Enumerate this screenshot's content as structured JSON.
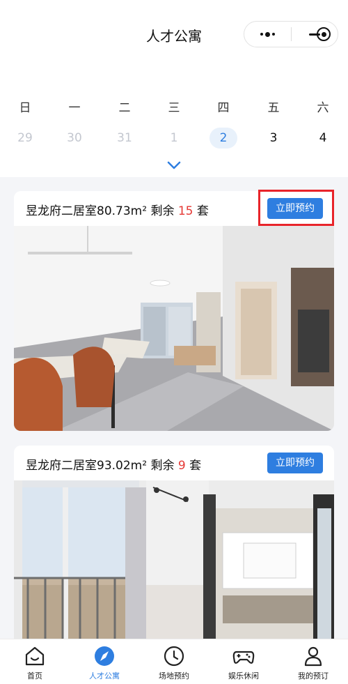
{
  "header": {
    "title": "人才公寓"
  },
  "calendar": {
    "weekdays": [
      "日",
      "一",
      "二",
      "三",
      "四",
      "五",
      "六"
    ],
    "dates": [
      "29",
      "30",
      "31",
      "1",
      "2",
      "3",
      "4"
    ]
  },
  "listings": [
    {
      "name": "昱龙府二居室80.73m²",
      "remaining_prefix": "剩余",
      "remaining_count": "15",
      "unit": "套",
      "book_label": "立即预约"
    },
    {
      "name": "昱龙府二居室93.02m²",
      "remaining_prefix": "剩余",
      "remaining_count": "9",
      "unit": "套",
      "book_label": "立即预约"
    }
  ],
  "tabbar": {
    "items": [
      {
        "label": "首页",
        "icon": "home-icon"
      },
      {
        "label": "人才公寓",
        "icon": "compass-icon"
      },
      {
        "label": "场地预约",
        "icon": "clock-icon"
      },
      {
        "label": "娱乐休闲",
        "icon": "gamepad-icon"
      },
      {
        "label": "我的预订",
        "icon": "user-icon"
      }
    ],
    "active_index": 1
  },
  "colors": {
    "accent": "#2e7ee0",
    "highlight_count": "#e53935",
    "annotation_box": "#e8242a"
  }
}
